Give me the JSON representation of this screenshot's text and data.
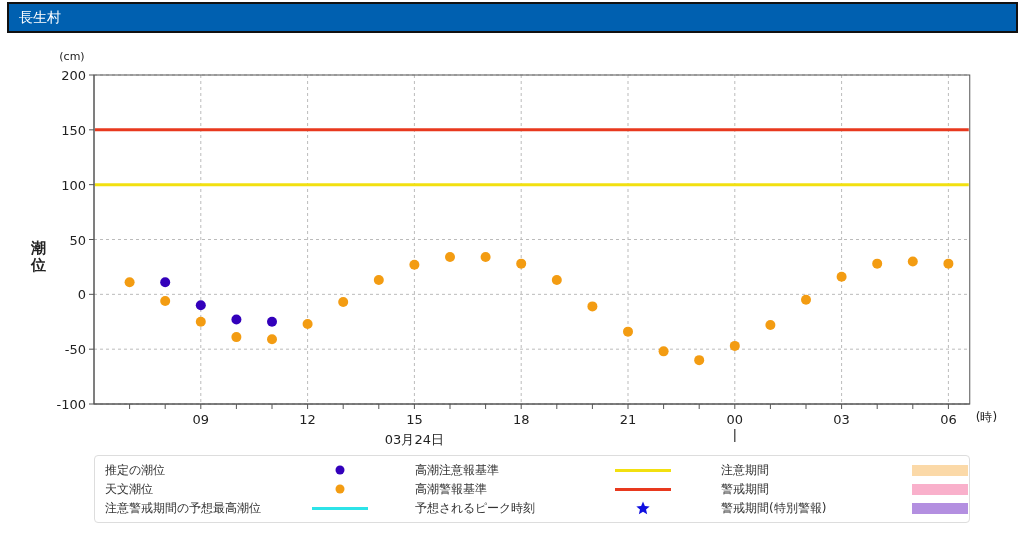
{
  "header": {
    "title": "長生村"
  },
  "chart": {
    "y_unit": "(cm)",
    "x_unit": "(時)",
    "chart_data": {
      "type": "scatter",
      "ylabel": "潮位",
      "ylim": [
        -100,
        200
      ],
      "yticks": [
        -100,
        -50,
        0,
        50,
        100,
        150,
        200
      ],
      "categories": [
        null,
        null,
        "09",
        null,
        null,
        "12",
        null,
        null,
        "15",
        null,
        null,
        "18",
        null,
        null,
        "21",
        null,
        null,
        "00",
        null,
        null,
        "03",
        null,
        null,
        "06"
      ],
      "series": [
        {
          "name": "推定の潮位",
          "color": "#3300bb",
          "values": [
            null,
            11,
            -10,
            -23,
            -25,
            null,
            null,
            null,
            null,
            null,
            null,
            null,
            null,
            null,
            null,
            null,
            null,
            null,
            null,
            null,
            null,
            null,
            null,
            null
          ]
        },
        {
          "name": "天文潮位",
          "color": "#f39c12",
          "values": [
            11,
            -6,
            -25,
            -39,
            -41,
            -27,
            -7,
            13,
            27,
            34,
            34,
            28,
            13,
            -11,
            -34,
            -52,
            -60,
            -47,
            -28,
            -5,
            16,
            28,
            30,
            28
          ]
        }
      ],
      "grid": true,
      "ref_lines": [
        {
          "axis": "y",
          "value": 150,
          "color": "#e8391e"
        },
        {
          "axis": "y",
          "value": 100,
          "color": "#f2e010"
        }
      ],
      "annotations": [
        "03月24日"
      ]
    }
  },
  "legend": [
    {
      "kind": "dot"
    },
    {
      "label": "高潮注意報基準",
      "kind": "line",
      "color": "#f2e010"
    },
    {
      "label": "注意期間",
      "kind": "band",
      "color": "#fbd9a8"
    },
    {
      "kind": "dot"
    },
    {
      "label": "高潮警報基準",
      "kind": "line",
      "color": "#e8391e"
    },
    {
      "label": "警戒期間",
      "kind": "band",
      "color": "#f9b0cb"
    },
    {
      "label": "注意警戒期間の予想最高潮位",
      "kind": "line",
      "color": "#2de3e8"
    },
    {
      "label": "予想されるピーク時刻",
      "kind": "star",
      "color": "#1010e0"
    },
    {
      "label": "警戒期間(特別警報)",
      "kind": "band",
      "color": "#b38fe0"
    }
  ]
}
